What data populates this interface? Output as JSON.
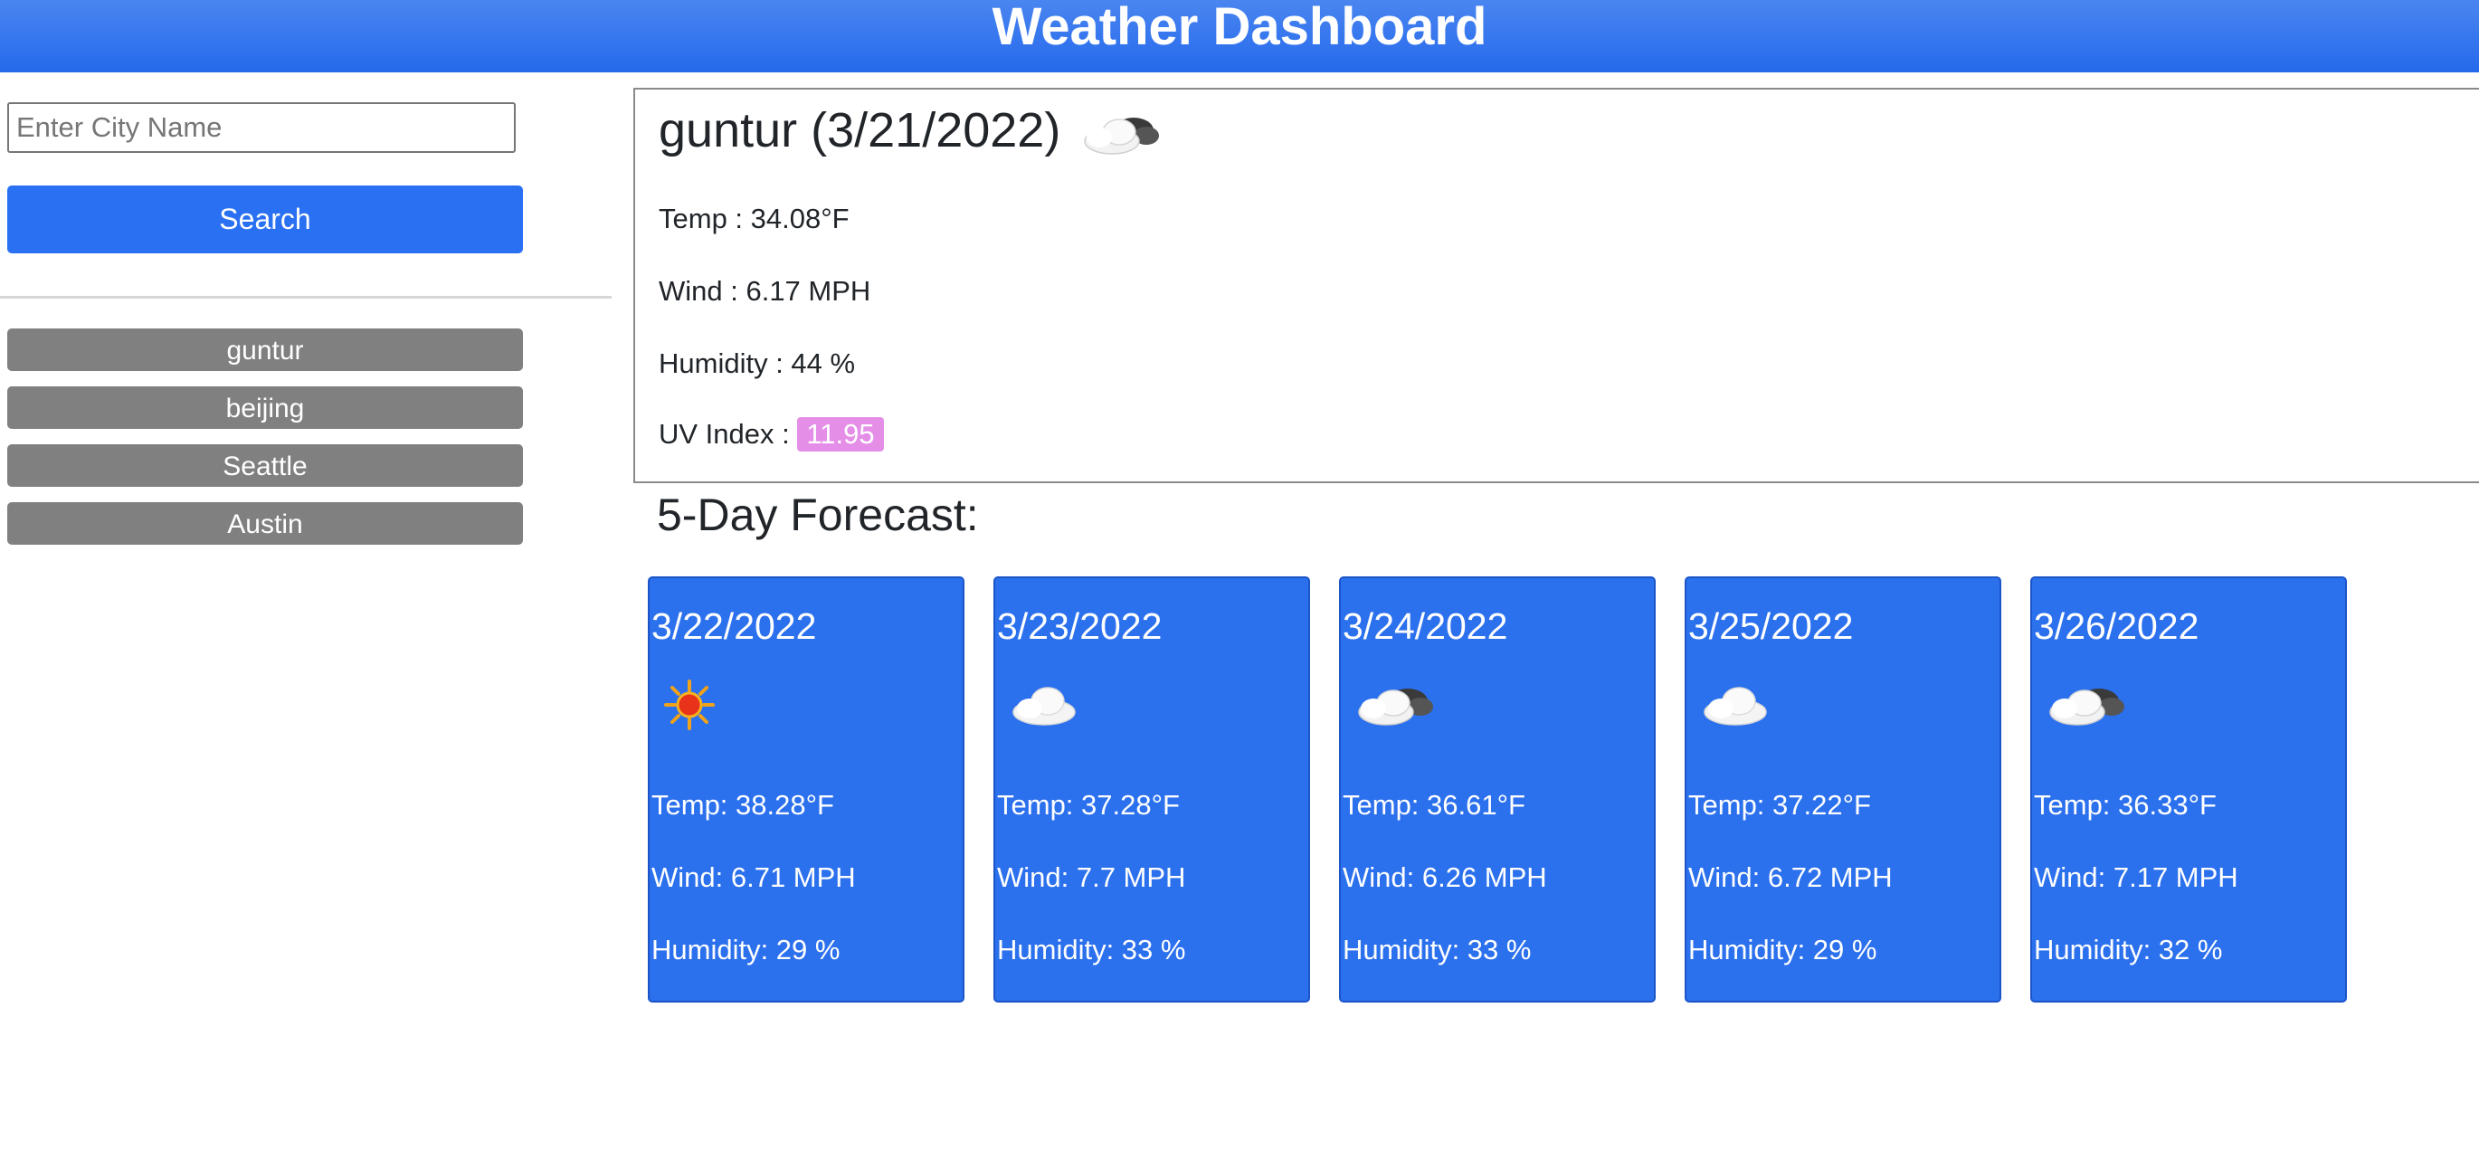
{
  "header": {
    "title": "Weather Dashboard"
  },
  "search": {
    "placeholder": "Enter City Name",
    "value": "",
    "button_label": "Search"
  },
  "history": [
    {
      "label": "guntur"
    },
    {
      "label": "beijing"
    },
    {
      "label": "Seattle"
    },
    {
      "label": "Austin"
    }
  ],
  "current": {
    "title": "guntur (3/21/2022)",
    "icon": "partly-cloudy-icon",
    "temp": "Temp : 34.08°F",
    "wind": "Wind : 6.17 MPH",
    "humidity": "Humidity : 44 %",
    "uv_label": "UV Index : ",
    "uv_value": "11.95",
    "uv_color": "#e58ee8"
  },
  "forecast": {
    "title": "5-Day Forecast:",
    "days": [
      {
        "date": "3/22/2022",
        "icon": "sun-icon",
        "temp": "Temp: 38.28°F",
        "wind": "Wind: 6.71 MPH",
        "humidity": "Humidity: 29 %"
      },
      {
        "date": "3/23/2022",
        "icon": "cloud-icon",
        "temp": "Temp: 37.28°F",
        "wind": "Wind: 7.7 MPH",
        "humidity": "Humidity: 33 %"
      },
      {
        "date": "3/24/2022",
        "icon": "partly-cloudy-icon",
        "temp": "Temp: 36.61°F",
        "wind": "Wind: 6.26 MPH",
        "humidity": "Humidity: 33 %"
      },
      {
        "date": "3/25/2022",
        "icon": "cloud-icon",
        "temp": "Temp: 37.22°F",
        "wind": "Wind: 6.72 MPH",
        "humidity": "Humidity: 29 %"
      },
      {
        "date": "3/26/2022",
        "icon": "partly-cloudy-icon",
        "temp": "Temp: 36.33°F",
        "wind": "Wind: 7.17 MPH",
        "humidity": "Humidity: 32 %"
      }
    ]
  },
  "colors": {
    "header": "#2569ec",
    "card": "#2b70ed",
    "history_button": "#808080",
    "search_button": "#2a70f2"
  }
}
